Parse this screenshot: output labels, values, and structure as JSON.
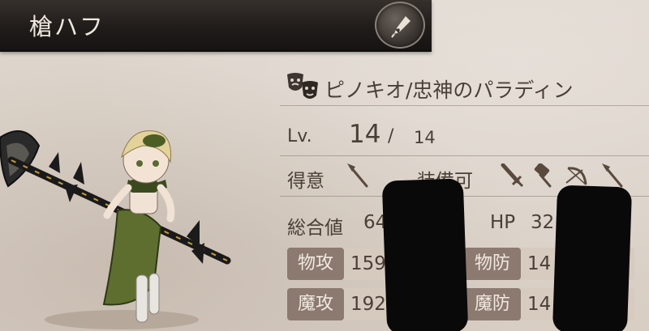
{
  "header": {
    "title": "槍ハフ"
  },
  "job": {
    "name": "ピノキオ/忠神のパラディン"
  },
  "level": {
    "label": "Lv.",
    "current": "14",
    "separator": "/",
    "max": "14"
  },
  "weapons": {
    "strong_label": "得意",
    "equip_label": "装備可"
  },
  "totals": {
    "total_label": "総合値",
    "total_value": "64",
    "hp_label": "HP",
    "hp_value": "32"
  },
  "stats": {
    "patk_label": "物攻",
    "patk_value": "159",
    "pdef_label": "物防",
    "pdef_value": "14",
    "matk_label": "魔攻",
    "matk_value": "192",
    "mdef_label": "魔防",
    "mdef_value": "14"
  },
  "icons": {
    "edit": "pen-nib-icon",
    "job": "theater-masks-icon",
    "strong_weapon": "spear-icon",
    "equip_weapons": [
      "sword-icon",
      "hammer-icon",
      "bow-icon",
      "spear-icon"
    ]
  }
}
